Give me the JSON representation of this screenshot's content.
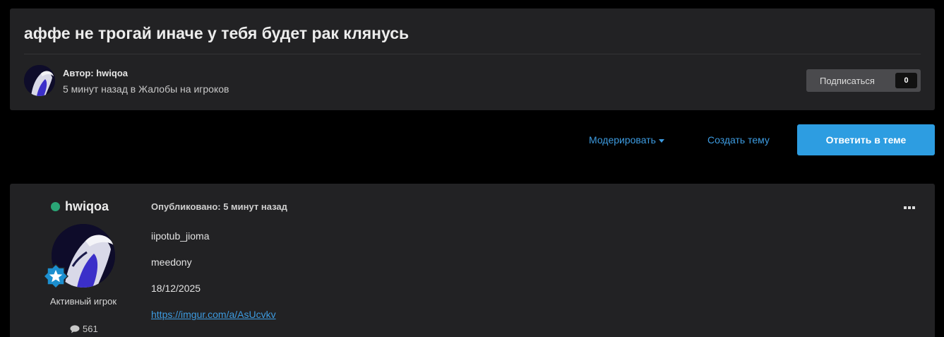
{
  "topic": {
    "title": "аффе не трогай иначе у тебя будет рак клянусь",
    "author_line": "Автор: hwiqoa",
    "meta_line": "5 минут назад в Жалобы на игроков"
  },
  "subscribe": {
    "label": "Подписаться",
    "count": "0"
  },
  "actions": {
    "moderate": "Модерировать",
    "create_topic": "Создать тему",
    "reply": "Ответить в теме"
  },
  "post": {
    "author": "hwiqoa",
    "rank": "Активный игрок",
    "post_count": "561",
    "published": "Опубликовано: 5 минут назад",
    "menu_icon": "ellipsis-icon",
    "lines": [
      "iipotub_jioma",
      "meedony",
      "18/12/2025"
    ],
    "link": "https://imgur.com/a/AsUcvkv"
  },
  "colors": {
    "accent": "#2d9de1",
    "link": "#3d9be0",
    "online": "#2aa576",
    "panel": "#222224"
  }
}
